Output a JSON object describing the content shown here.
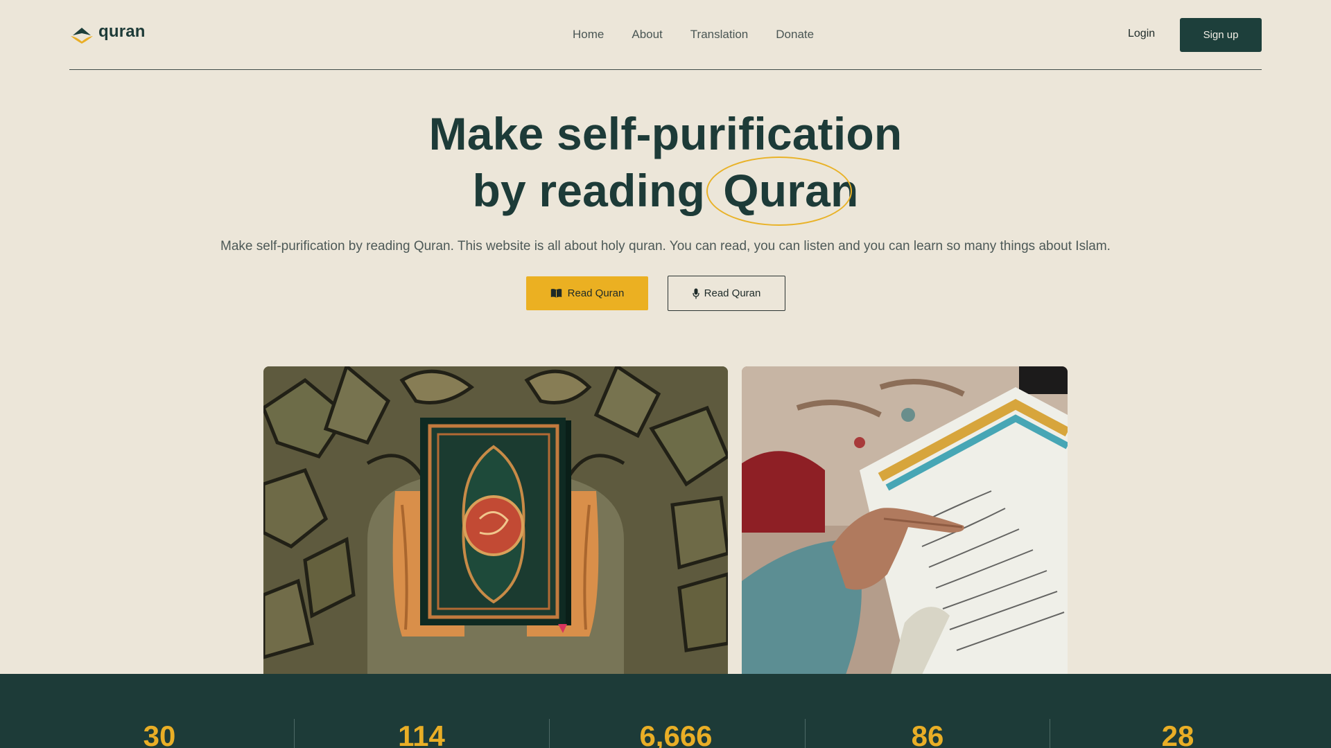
{
  "brand": {
    "name": "quran"
  },
  "nav": [
    {
      "label": "Home"
    },
    {
      "label": "About"
    },
    {
      "label": "Translation"
    },
    {
      "label": "Donate"
    }
  ],
  "auth": {
    "login_label": "Login",
    "signup_label": "Sign up"
  },
  "hero": {
    "title_line1": "Make self-purification",
    "title_line2_prefix": "by reading",
    "title_highlight": "Quran",
    "subtitle": "Make self-purification by reading Quran. This website is all about holy quran. You can read, you can listen and you can learn so many things about Islam.",
    "primary_button": {
      "label": "Read Quran",
      "icon": "open-book-icon"
    },
    "secondary_button": {
      "label": "Read Quran",
      "icon": "microphone-icon"
    }
  },
  "images": [
    {
      "name": "quran-book-on-stand-photo"
    },
    {
      "name": "reading-quran-photo"
    }
  ],
  "stats": [
    {
      "value": "30"
    },
    {
      "value": "114"
    },
    {
      "value": "6,666"
    },
    {
      "value": "86"
    },
    {
      "value": "28"
    }
  ],
  "colors": {
    "background": "#ECE6D9",
    "brand_dark": "#1D3B38",
    "accent": "#EBB022"
  }
}
